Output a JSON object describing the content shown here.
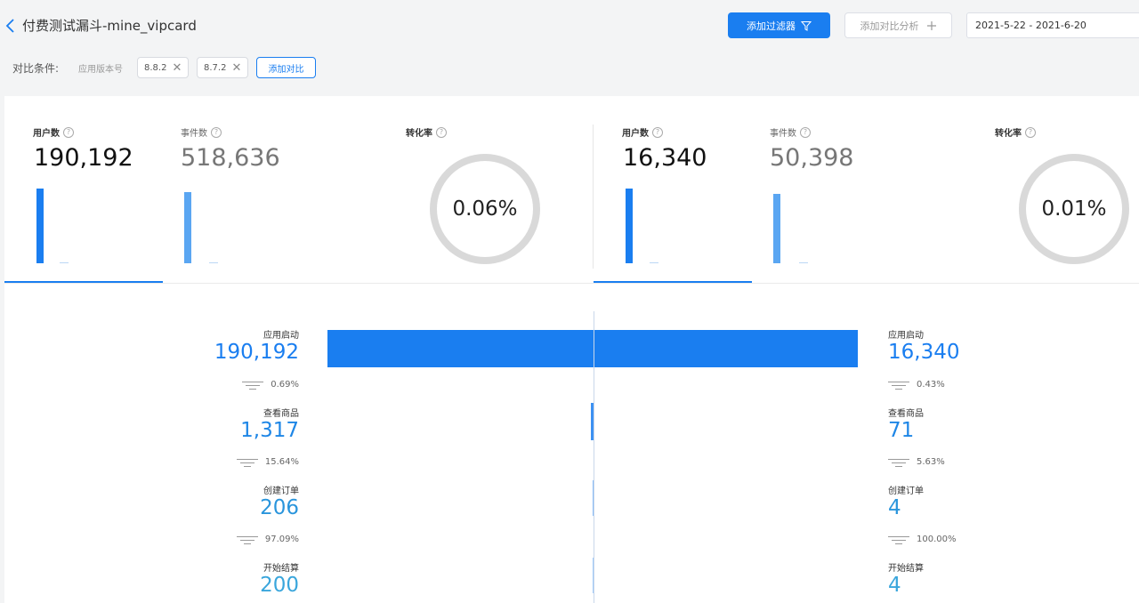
{
  "header": {
    "title": "付费测试漏斗-mine_vipcard",
    "add_filter_label": "添加过滤器",
    "add_compare_label": "添加对比分析",
    "date_range": "2021-5-22 - 2021-6-20"
  },
  "compare": {
    "label": "对比条件:",
    "dimension": "应用版本号",
    "tags": [
      "8.8.2",
      "8.7.2"
    ],
    "add_label": "添加对比"
  },
  "panels": [
    {
      "users_label": "用户数",
      "users_value": "190,192",
      "events_label": "事件数",
      "events_value": "518,636",
      "conversion_label": "转化率",
      "conversion_value": "0.06%"
    },
    {
      "users_label": "用户数",
      "users_value": "16,340",
      "events_label": "事件数",
      "events_value": "50,398",
      "conversion_label": "转化率",
      "conversion_value": "0.01%"
    }
  ],
  "funnel": {
    "left": [
      {
        "stage": "应用启动",
        "value": "190,192",
        "rate": "0.69%"
      },
      {
        "stage": "查看商品",
        "value": "1,317",
        "rate": "15.64%"
      },
      {
        "stage": "创建订单",
        "value": "206",
        "rate": "97.09%"
      },
      {
        "stage": "开始结算",
        "value": "200",
        "rate": ""
      }
    ],
    "right": [
      {
        "stage": "应用启动",
        "value": "16,340",
        "rate": "0.43%"
      },
      {
        "stage": "查看商品",
        "value": "71",
        "rate": "5.63%"
      },
      {
        "stage": "创建订单",
        "value": "4",
        "rate": "100.00%"
      },
      {
        "stage": "开始结算",
        "value": "4",
        "rate": ""
      }
    ]
  },
  "colors": {
    "primary": "#1a7ef0",
    "value_blue_1": "#1a7ef0",
    "value_blue_2": "#2a9be0",
    "ring": "#d9d9d9"
  },
  "icons": [
    "chevron-left-icon",
    "filter-icon",
    "plus-icon",
    "close-icon",
    "help-circle-icon",
    "funnel-lines-icon"
  ]
}
